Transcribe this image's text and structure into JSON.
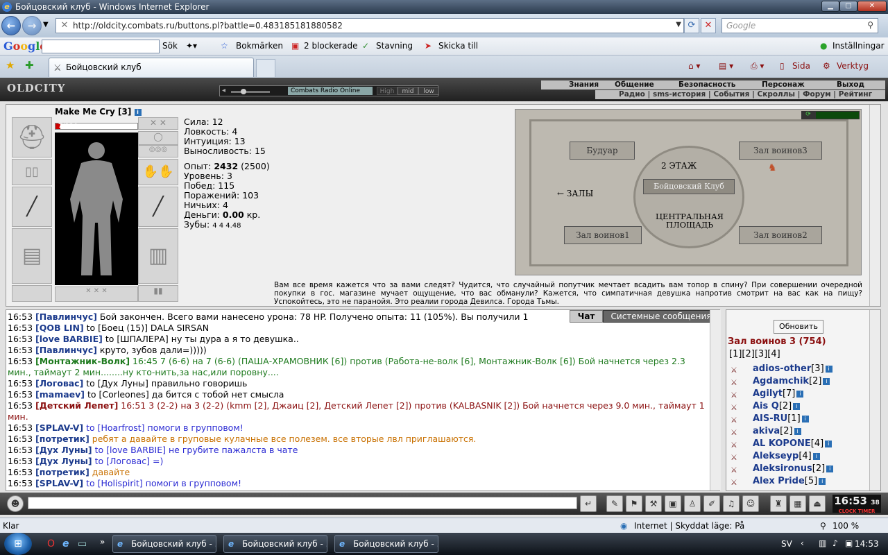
{
  "window": {
    "title": "Бойцовский клуб - Windows Internet Explorer"
  },
  "address": {
    "url": "http://oldcity.combats.ru/buttons.pl?battle=0.483185181880582",
    "search_placeholder": "Google"
  },
  "gtoolbar": {
    "logo": "Google",
    "sok": "Sök",
    "bookmarks": "Bokmärken",
    "blocked": "2 blockerade",
    "spelling": "Stavning",
    "send": "Skicka till",
    "settings": "Inställningar"
  },
  "tab": {
    "label": "Бойцовский клуб",
    "page_menu": "Sida",
    "tools_menu": "Verktyg"
  },
  "game": {
    "logo": "OLDCITY",
    "radio": {
      "name": "Combats Radio Online",
      "high": "High",
      "mid": "mid",
      "low": "low"
    },
    "menu_top": [
      "Знания",
      "Общение",
      "Безопасность",
      "Персонаж",
      "Выход"
    ],
    "menu_bottom": "Радио | sms-история | События | Скроллы | Форум | Рейтинг",
    "character": {
      "name": "Make Me Cry",
      "level": "[3]",
      "hp": "7/120",
      "hp_fraction": 0.058,
      "stats": [
        {
          "label": "Сила:",
          "value": "12"
        },
        {
          "label": "Ловкость:",
          "value": "4"
        },
        {
          "label": "Интуиция:",
          "value": "13"
        },
        {
          "label": "Выносливость:",
          "value": "15"
        }
      ],
      "exp_label": "Опыт:",
      "exp": "2432",
      "exp_next": "(2500)",
      "rows": [
        {
          "label": "Уровень:",
          "value": "3"
        },
        {
          "label": "Побед:",
          "value": "115"
        },
        {
          "label": "Поражений:",
          "value": "103"
        },
        {
          "label": "Ничьих:",
          "value": "4"
        }
      ],
      "money_label": "Деньги:",
      "money": "0.00",
      "money_unit": "кр.",
      "teeth_label": "Зубы:",
      "teeth": "4  4  4.48"
    },
    "map": {
      "boudoir": "Будуар",
      "hall3": "Зал воинов3",
      "floor2": "2 ЭТАЖ",
      "club": "Бойцовский Клуб",
      "halls": "← ЗАЛЫ",
      "central": "ЦЕНТРАЛЬНАЯ ПЛОЩАДЬ",
      "hall1": "Зал воинов1",
      "hall2": "Зал воинов2"
    },
    "description": "Вам все время кажется что за вами следят? Чудится, что случайный попутчик мечтает всадить вам топор в спину? При совершении очередной покупки в гос. магазине мучает ощущение, что вас обманули? Кажется, что симпатичная девушка напротив смотрит на вас как на пищу? Успокойтесь, это не паранойя. Это реалии города Девилса. Города Тьмы.",
    "chat_tabs": {
      "chat": "Чат",
      "system": "Системные сообщения"
    },
    "chat": [
      {
        "time": "16:53",
        "nick": "[Павлинчус]",
        "text": " Бой закончен. Всего вами нанесено урона: 78 HP. Получено опыта: 11 (105%). Вы получили 1",
        "cls": "tm"
      },
      {
        "time": "16:53",
        "nick": "[QOB LIN]",
        "text": " to [Боец (15)] DALA SIRSAN",
        "cls": "tm"
      },
      {
        "time": "16:53",
        "nick": "[love BARBIE]",
        "text": " to [ШПАЛЕРА] ну ты дура а я то девушка..",
        "cls": "tm"
      },
      {
        "time": "16:53",
        "nick": "[Павлинчус]",
        "text": " круто, зубов дали=)))))",
        "cls": "tm"
      },
      {
        "time": "16:53",
        "nick": "[Монтажник-Волк]",
        "text": " 16:45 7 (6-6) на 7 (6-6) (ПАША-ХРАМОВНИК [6]) против (Работа-не-волк [6], Монтажник-Волк [6]) Бой начнется через 2.3 мин., таймаут 2 мин........ну кто-нить,за нас,или поровну....",
        "cls": "g"
      },
      {
        "time": "16:53",
        "nick": "[Логовас]",
        "text": " to [Дух Луны] правильно говоришь",
        "cls": "tm"
      },
      {
        "time": "16:53",
        "nick": "[mamaev]",
        "text": " to [Corleones] да бится с тобой нет смысла",
        "cls": "tm"
      },
      {
        "time": "16:53",
        "nick": "[Детский Лепет]",
        "text": " 16:51 3 (2-2) на 3 (2-2) (kmm [2], Джаиц [2], Детский Лепет [2]) против (KALBASNIK [2]) Бой начнется через 9.0 мин., таймаут 1 мин.",
        "cls": "r"
      },
      {
        "time": "16:53",
        "nick": "[SPLAV-V]",
        "text": " to [Hoarfrost] помоги в групповом!",
        "cls": "b"
      },
      {
        "time": "16:53",
        "nick": "[потретик]",
        "text": " ребят а давайте в груповые кулачные все полезем. все вторые лвл приглашаются.",
        "cls": "o"
      },
      {
        "time": "16:53",
        "nick": "[Дух Луны]",
        "text": " to [love BARBIE] не грубите пажалста в чате",
        "cls": "b"
      },
      {
        "time": "16:53",
        "nick": "[Дух Луны]",
        "text": " to [Логовас] =)",
        "cls": "b"
      },
      {
        "time": "16:53",
        "nick": "[потретик]",
        "text": " давайте",
        "cls": "o"
      },
      {
        "time": "16:53",
        "nick": "[SPLAV-V]",
        "text": " to [Holispirit] помоги в групповом!",
        "cls": "b"
      }
    ],
    "userlist": {
      "refresh": "Обновить",
      "room": "Зал воинов 3 (754)",
      "pages": "[1][2][3][4]",
      "users": [
        {
          "name": "adios-other",
          "level": "[3]"
        },
        {
          "name": "Agdamchik",
          "level": "[2]"
        },
        {
          "name": "Agilyt",
          "level": "[7]"
        },
        {
          "name": "Ais Q",
          "level": "[2]"
        },
        {
          "name": "AIS-RU",
          "level": "[1]"
        },
        {
          "name": "akiva",
          "level": "[2]"
        },
        {
          "name": "AL KOPONE",
          "level": "[4]"
        },
        {
          "name": "Alekseyp",
          "level": "[4]"
        },
        {
          "name": "Aleksironus",
          "level": "[2]"
        },
        {
          "name": "Alex Pride",
          "level": "[5]"
        }
      ]
    },
    "clock": {
      "time": "16:53",
      "seconds": "38",
      "labels": "CLOCK TIMER"
    }
  },
  "status": {
    "left": "Klar",
    "zone": "Internet | Skyddat läge: På",
    "zoom": "100 %"
  },
  "taskbar": {
    "items": [
      "Бойцовский клуб - ...",
      "Бойцовский клуб - ...",
      "Бойцовский клуб - ..."
    ],
    "lang": "SV",
    "time": "14:53"
  }
}
